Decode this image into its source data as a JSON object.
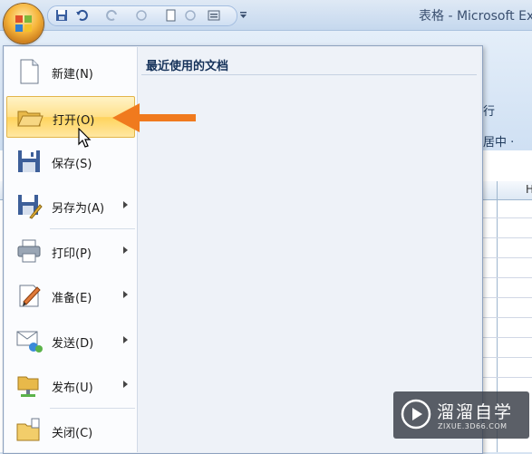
{
  "window": {
    "title": "表格 - Microsoft Excel",
    "ribbon_fragments": [
      "行",
      "居中 ·"
    ],
    "column_header": "H"
  },
  "office_menu": {
    "items": [
      {
        "label": "新建(N)",
        "icon": "new-document-icon",
        "submenu": false
      },
      {
        "label": "打开(O)",
        "icon": "open-folder-icon",
        "submenu": false,
        "highlighted": true
      },
      {
        "label": "保存(S)",
        "icon": "save-disk-icon",
        "submenu": false
      },
      {
        "label": "另存为(A)",
        "icon": "save-as-icon",
        "submenu": true
      },
      {
        "label": "打印(P)",
        "icon": "printer-icon",
        "submenu": true
      },
      {
        "label": "准备(E)",
        "icon": "prepare-icon",
        "submenu": true
      },
      {
        "label": "发送(D)",
        "icon": "send-icon",
        "submenu": true
      },
      {
        "label": "发布(U)",
        "icon": "publish-icon",
        "submenu": true
      },
      {
        "label": "关闭(C)",
        "icon": "close-folder-icon",
        "submenu": false
      }
    ],
    "recent_title": "最近使用的文档"
  },
  "annotation": {
    "arrow_color": "#f07a1e"
  },
  "watermark": {
    "name": "溜溜自学",
    "url": "ZIXUE.3D66.COM"
  }
}
